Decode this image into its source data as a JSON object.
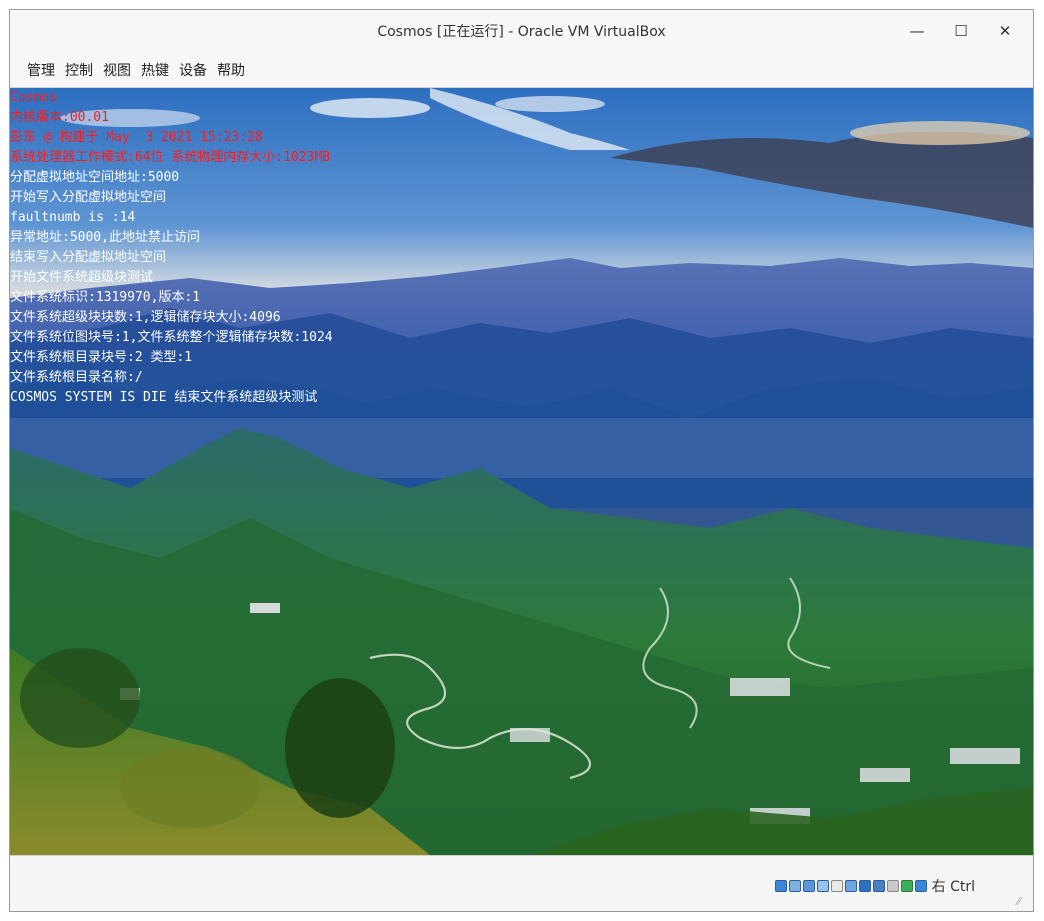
{
  "window": {
    "title": "Cosmos [正在运行] - Oracle VM VirtualBox",
    "controls": {
      "minimize": "—",
      "maximize": "☐",
      "close": "✕"
    }
  },
  "menu": {
    "items": [
      "管理",
      "控制",
      "视图",
      "热键",
      "设备",
      "帮助"
    ]
  },
  "console": {
    "lines": [
      {
        "text": "Cosmos",
        "color": "#ff1a1a"
      },
      {
        "text": "内核版本:00.01",
        "color": "#ff1a1a"
      },
      {
        "text": "彭东 @ 构建于 May  3 2021 15:23:28",
        "color": "#ff1a1a"
      },
      {
        "text": "系统处理器工作模式:64位 系统物理内存大小:1023MB",
        "color": "#ff1a1a"
      },
      {
        "text": "分配虚拟地址空间地址:5000",
        "color": "#ffffff"
      },
      {
        "text": "开始写入分配虚拟地址空间",
        "color": "#ffffff"
      },
      {
        "text": "faultnumb is :14",
        "color": "#ffffff"
      },
      {
        "text": "异常地址:5000,此地址禁止访问",
        "color": "#ffffff"
      },
      {
        "text": "结束写入分配虚拟地址空间",
        "color": "#ffffff"
      },
      {
        "text": "开始文件系统超级块测试",
        "color": "#ffffff"
      },
      {
        "text": "文件系统标识:1319970,版本:1",
        "color": "#ffffff"
      },
      {
        "text": "文件系统超级块块数:1,逻辑储存块大小:4096",
        "color": "#ffffff"
      },
      {
        "text": "文件系统位图块号:1,文件系统整个逻辑储存块数:1024",
        "color": "#ffffff"
      },
      {
        "text": "文件系统根目录块号:2 类型:1",
        "color": "#ffffff"
      },
      {
        "text": "文件系统根目录名称:/",
        "color": "#ffffff"
      },
      {
        "text": "COSMOS SYSTEM IS DIE 结束文件系统超级块测试",
        "color": "#ffffff"
      }
    ]
  },
  "statusbar": {
    "icons": [
      "hard-disk-icon",
      "optical-drive-icon",
      "audio-icon",
      "network-icon",
      "usb-icon",
      "shared-folders-icon",
      "display-icon",
      "video-capture-icon",
      "cpu-icon",
      "mouse-integration-icon",
      "keyboard-icon"
    ],
    "host_key": "右 Ctrl"
  },
  "colors": {
    "error_text": "#ff1a1a",
    "info_text": "#ffffff"
  }
}
